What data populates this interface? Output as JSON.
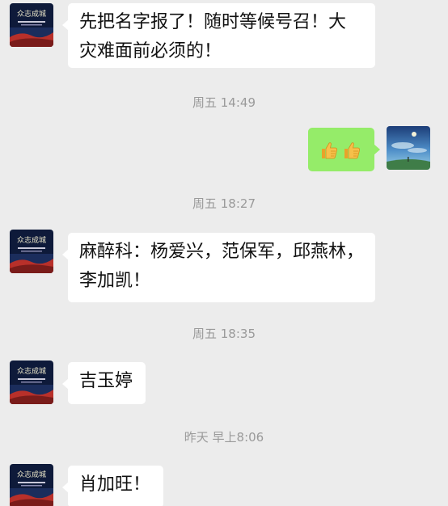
{
  "messages": [
    {
      "side": "left",
      "lines": [
        "先把名字报了！随时等候号召！大",
        "灾难面前必须的！"
      ]
    },
    {
      "side": "right",
      "content": "👍👍"
    },
    {
      "side": "left",
      "lines": [
        "麻醉科：杨爱兴，范保军，邱燕林，",
        "李加凯！"
      ]
    },
    {
      "side": "left",
      "text": "吉玉婷"
    },
    {
      "side": "left",
      "text": "肖加旺！"
    }
  ],
  "timestamps": [
    "周五 14:49",
    "周五 18:27",
    "周五 18:35",
    "昨天 早上8:06"
  ],
  "icons": {
    "group_avatar": "group-avatar-night-banner",
    "user_avatar": "user-avatar-sky-landscape",
    "thumbs_up": "thumbs-up-emoji"
  }
}
